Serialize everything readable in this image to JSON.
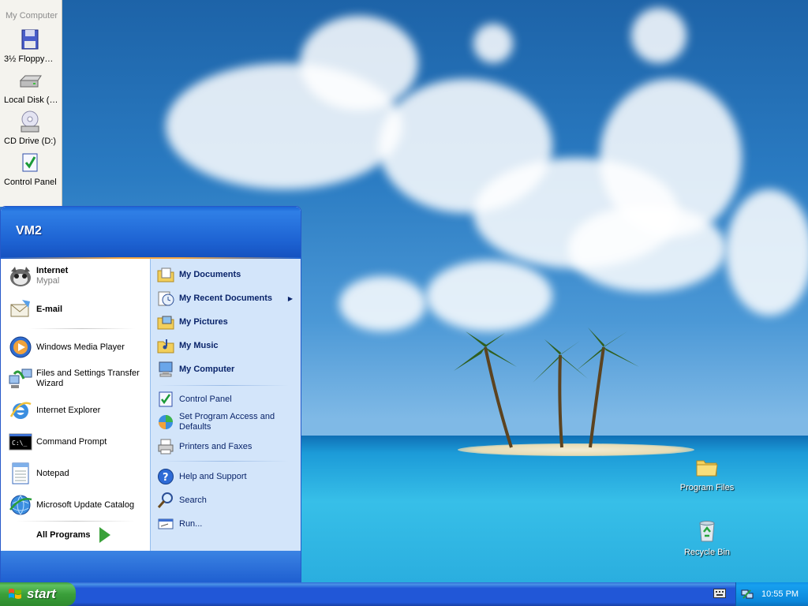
{
  "my_computer_panel": {
    "title": "My Computer",
    "items": [
      {
        "label": "3½ Floppy…",
        "icon": "floppy-drive-icon"
      },
      {
        "label": "Local Disk (…",
        "icon": "hard-disk-icon"
      },
      {
        "label": "CD Drive (D:)",
        "icon": "cd-drive-icon"
      },
      {
        "label": "Control Panel",
        "icon": "control-panel-icon"
      }
    ]
  },
  "start_menu": {
    "user": "VM2",
    "pinned": [
      {
        "title": "Internet",
        "subtitle": "Mypal",
        "icon": "mypal-browser-icon"
      },
      {
        "title": "E-mail",
        "icon": "email-icon"
      }
    ],
    "recent": [
      {
        "label": "Windows Media Player",
        "icon": "media-player-icon"
      },
      {
        "label": "Files and Settings Transfer Wizard",
        "icon": "transfer-wizard-icon"
      },
      {
        "label": "Internet Explorer",
        "icon": "internet-explorer-icon"
      },
      {
        "label": "Command Prompt",
        "icon": "command-prompt-icon"
      },
      {
        "label": "Notepad",
        "icon": "notepad-icon"
      },
      {
        "label": "Microsoft Update Catalog",
        "icon": "update-catalog-icon"
      }
    ],
    "all_programs": "All Programs",
    "right": [
      {
        "label": "My Documents",
        "icon": "documents-folder-icon"
      },
      {
        "label": "My Recent Documents",
        "icon": "recent-documents-icon"
      },
      {
        "label": "My Pictures",
        "icon": "pictures-folder-icon"
      },
      {
        "label": "My Music",
        "icon": "music-folder-icon"
      },
      {
        "label": "My Computer",
        "icon": "computer-icon"
      },
      {
        "label": "Control Panel",
        "icon": "control-panel-icon"
      },
      {
        "label": "Set Program Access and Defaults",
        "icon": "program-access-icon"
      },
      {
        "label": "Printers and Faxes",
        "icon": "printer-icon"
      },
      {
        "label": "Help and Support",
        "icon": "help-icon"
      },
      {
        "label": "Search",
        "icon": "search-icon"
      },
      {
        "label": "Run...",
        "icon": "run-icon"
      }
    ]
  },
  "desktop_icons": [
    {
      "label": "Program Files",
      "icon": "folder-icon"
    },
    {
      "label": "Recycle Bin",
      "icon": "recycle-bin-icon"
    }
  ],
  "taskbar": {
    "start_label": "start",
    "clock": "10:55 PM"
  }
}
